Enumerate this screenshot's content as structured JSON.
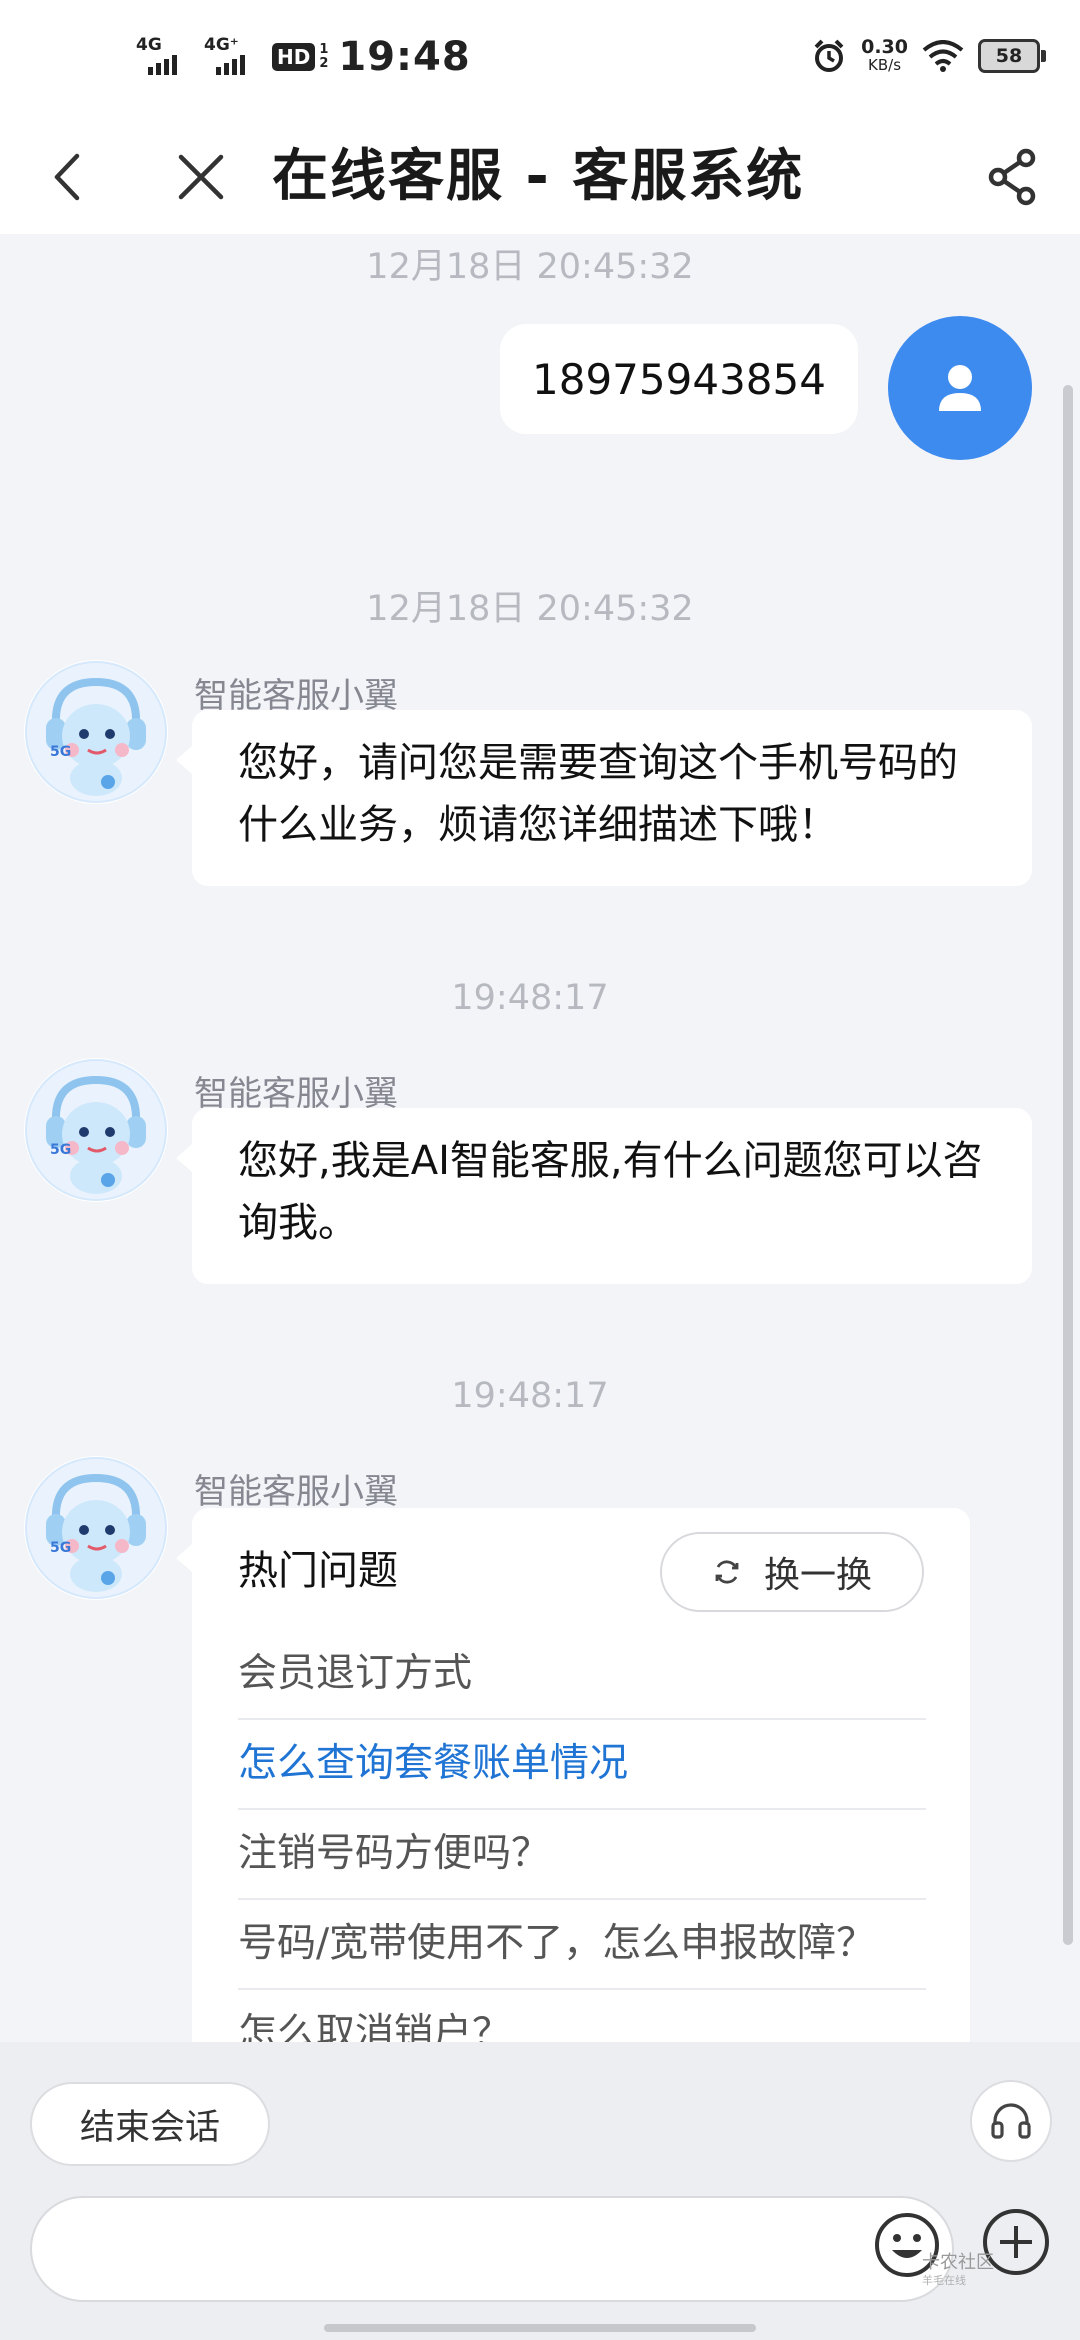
{
  "status_bar": {
    "network1": "4G",
    "network2": "4G⁺",
    "hd": "HD",
    "hd_sub1": "1",
    "hd_sub2": "2",
    "time": "19:48",
    "speed_value": "0.30",
    "speed_unit": "KB/s",
    "battery": "58"
  },
  "header": {
    "title": "在线客服 - 客服系统",
    "back_icon": "chevron-left-icon",
    "close_icon": "close-icon",
    "share_icon": "share-icon"
  },
  "chat": {
    "messages": [
      {
        "type": "timestamp",
        "text": "12月18日 20:45:32"
      },
      {
        "type": "user",
        "text": "18975943854"
      },
      {
        "type": "timestamp",
        "text": "12月18日 20:45:32"
      },
      {
        "type": "bot",
        "name": "智能客服小翼",
        "text": "您好，请问您是需要查询这个手机号码的什么业务，烦请您详细描述下哦！"
      },
      {
        "type": "timestamp",
        "text": "19:48:17"
      },
      {
        "type": "bot",
        "name": "智能客服小翼",
        "text": "您好,我是AI智能客服,有什么问题您可以咨询我。"
      },
      {
        "type": "timestamp",
        "text": "19:48:17"
      },
      {
        "type": "bot",
        "name": "智能客服小翼"
      }
    ],
    "hot_card": {
      "title": "热门问题",
      "refresh_label": "换一换",
      "questions": [
        "会员退订方式",
        "怎么查询套餐账单情况",
        "注销号码方便吗？",
        "号码/宽带使用不了，怎么申报故障？",
        "怎么取消销户？"
      ],
      "active_index": 1
    }
  },
  "bottom": {
    "end_label": "结束会话",
    "input_value": "",
    "watermark_main": "卡农社区",
    "watermark_sub": "羊毛在线"
  },
  "colors": {
    "accent": "#3e8bf0",
    "link": "#1f74d4",
    "background": "#f3f4f8"
  }
}
